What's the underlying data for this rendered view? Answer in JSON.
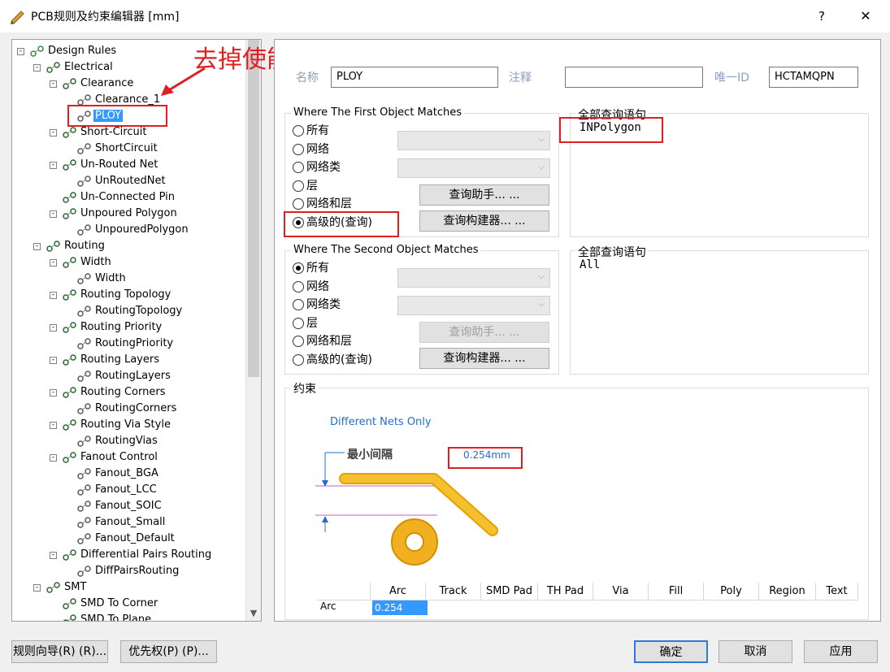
{
  "window": {
    "title": "PCB规则及约束编辑器 [mm]",
    "help": "?",
    "close": "✕"
  },
  "annotation": {
    "text": "去掉使能"
  },
  "tree": [
    {
      "label": "Design Rules",
      "level": 0,
      "icon": "rules-folder-icon",
      "expand": "-"
    },
    {
      "label": "Electrical",
      "level": 1,
      "icon": "electrical-icon",
      "expand": "-"
    },
    {
      "label": "Clearance",
      "level": 2,
      "icon": "clearance-icon",
      "expand": "-"
    },
    {
      "label": "Clearance_1",
      "level": 3,
      "icon": "clearance-rule-icon"
    },
    {
      "label": "PLOY",
      "level": 3,
      "icon": "clearance-rule-icon",
      "selected": true
    },
    {
      "label": "Short-Circuit",
      "level": 2,
      "icon": "short-circuit-icon",
      "expand": "-"
    },
    {
      "label": "ShortCircuit",
      "level": 3,
      "icon": "short-circuit-rule-icon"
    },
    {
      "label": "Un-Routed Net",
      "level": 2,
      "icon": "unrouted-net-icon",
      "expand": "-"
    },
    {
      "label": "UnRoutedNet",
      "level": 3,
      "icon": "unrouted-net-rule-icon"
    },
    {
      "label": "Un-Connected Pin",
      "level": 2,
      "icon": "unconnected-pin-icon"
    },
    {
      "label": "Unpoured Polygon",
      "level": 2,
      "icon": "unpoured-polygon-icon",
      "expand": "-"
    },
    {
      "label": "UnpouredPolygon",
      "level": 3,
      "icon": "unpoured-polygon-rule-icon"
    },
    {
      "label": "Routing",
      "level": 1,
      "icon": "routing-icon",
      "expand": "-"
    },
    {
      "label": "Width",
      "level": 2,
      "icon": "width-icon",
      "expand": "-"
    },
    {
      "label": "Width",
      "level": 3,
      "icon": "width-rule-icon"
    },
    {
      "label": "Routing Topology",
      "level": 2,
      "icon": "topology-icon",
      "expand": "-"
    },
    {
      "label": "RoutingTopology",
      "level": 3,
      "icon": "topology-rule-icon"
    },
    {
      "label": "Routing Priority",
      "level": 2,
      "icon": "priority-icon",
      "expand": "-"
    },
    {
      "label": "RoutingPriority",
      "level": 3,
      "icon": "priority-rule-icon"
    },
    {
      "label": "Routing Layers",
      "level": 2,
      "icon": "layers-icon",
      "expand": "-"
    },
    {
      "label": "RoutingLayers",
      "level": 3,
      "icon": "layers-rule-icon"
    },
    {
      "label": "Routing Corners",
      "level": 2,
      "icon": "corners-icon",
      "expand": "-"
    },
    {
      "label": "RoutingCorners",
      "level": 3,
      "icon": "corners-rule-icon"
    },
    {
      "label": "Routing Via Style",
      "level": 2,
      "icon": "via-style-icon",
      "expand": "-"
    },
    {
      "label": "RoutingVias",
      "level": 3,
      "icon": "via-style-rule-icon"
    },
    {
      "label": "Fanout Control",
      "level": 2,
      "icon": "fanout-icon",
      "expand": "-"
    },
    {
      "label": "Fanout_BGA",
      "level": 3,
      "icon": "fanout-rule-icon"
    },
    {
      "label": "Fanout_LCC",
      "level": 3,
      "icon": "fanout-rule-icon"
    },
    {
      "label": "Fanout_SOIC",
      "level": 3,
      "icon": "fanout-rule-icon"
    },
    {
      "label": "Fanout_Small",
      "level": 3,
      "icon": "fanout-rule-icon"
    },
    {
      "label": "Fanout_Default",
      "level": 3,
      "icon": "fanout-rule-icon"
    },
    {
      "label": "Differential Pairs Routing",
      "level": 2,
      "icon": "diff-pairs-icon",
      "expand": "-"
    },
    {
      "label": "DiffPairsRouting",
      "level": 3,
      "icon": "diff-pairs-rule-icon"
    },
    {
      "label": "SMT",
      "level": 1,
      "icon": "smt-icon",
      "expand": "-"
    },
    {
      "label": "SMD To Corner",
      "level": 2,
      "icon": "smd-corner-icon"
    },
    {
      "label": "SMD To Plane",
      "level": 2,
      "icon": "smd-plane-icon"
    }
  ],
  "rule": {
    "name_label": "名称",
    "name_value": "PLOY",
    "comment_label": "注释",
    "comment_value": "",
    "uid_label": "唯一ID",
    "uid_value": "HCTAMQPN"
  },
  "first_match": {
    "title": "Where The First Object Matches",
    "options": [
      "所有",
      "网络",
      "网络类",
      "层",
      "网络和层",
      "高级的(查询)"
    ],
    "selected": 5,
    "query_helper": "查询助手... ...",
    "query_builder": "查询构建器... ...",
    "query_title": "全部查询语句",
    "query_text": "INPolygon"
  },
  "second_match": {
    "title": "Where The Second Object Matches",
    "options": [
      "所有",
      "网络",
      "网络类",
      "层",
      "网络和层",
      "高级的(查询)"
    ],
    "selected": 0,
    "query_helper": "查询助手... ...",
    "query_builder": "查询构建器... ...",
    "query_title": "全部查询语句",
    "query_text": "All"
  },
  "constraints": {
    "title": "约束",
    "mode": "Different Nets Only",
    "min_clearance_label": "最小间隔",
    "min_clearance_value": "0.254mm",
    "table_headers": [
      "",
      "Arc",
      "Track",
      "SMD Pad",
      "TH Pad",
      "Via",
      "Fill",
      "Poly",
      "Region",
      "Text"
    ],
    "table_row_label": "Arc",
    "table_row_value": "0.254"
  },
  "buttons": {
    "rule_wizard": "规则向导(R) (R)...",
    "priority": "优先权(P) (P)...",
    "ok": "确定",
    "cancel": "取消",
    "apply": "应用"
  },
  "colors": {
    "accent": "#3399ff",
    "highlight": "#e02020",
    "copper": "#f0b020",
    "blue_text": "#1f6fd0"
  }
}
